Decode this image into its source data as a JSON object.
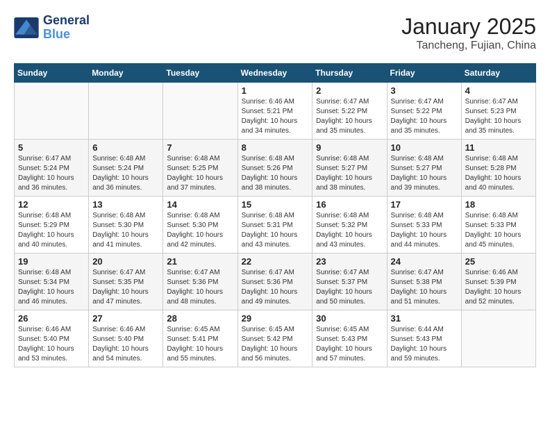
{
  "header": {
    "logo_line1": "General",
    "logo_line2": "Blue",
    "month": "January 2025",
    "location": "Tancheng, Fujian, China"
  },
  "days_of_week": [
    "Sunday",
    "Monday",
    "Tuesday",
    "Wednesday",
    "Thursday",
    "Friday",
    "Saturday"
  ],
  "weeks": [
    [
      {
        "num": "",
        "info": ""
      },
      {
        "num": "",
        "info": ""
      },
      {
        "num": "",
        "info": ""
      },
      {
        "num": "1",
        "info": "Sunrise: 6:46 AM\nSunset: 5:21 PM\nDaylight: 10 hours\nand 34 minutes."
      },
      {
        "num": "2",
        "info": "Sunrise: 6:47 AM\nSunset: 5:22 PM\nDaylight: 10 hours\nand 35 minutes."
      },
      {
        "num": "3",
        "info": "Sunrise: 6:47 AM\nSunset: 5:22 PM\nDaylight: 10 hours\nand 35 minutes."
      },
      {
        "num": "4",
        "info": "Sunrise: 6:47 AM\nSunset: 5:23 PM\nDaylight: 10 hours\nand 35 minutes."
      }
    ],
    [
      {
        "num": "5",
        "info": "Sunrise: 6:47 AM\nSunset: 5:24 PM\nDaylight: 10 hours\nand 36 minutes."
      },
      {
        "num": "6",
        "info": "Sunrise: 6:48 AM\nSunset: 5:24 PM\nDaylight: 10 hours\nand 36 minutes."
      },
      {
        "num": "7",
        "info": "Sunrise: 6:48 AM\nSunset: 5:25 PM\nDaylight: 10 hours\nand 37 minutes."
      },
      {
        "num": "8",
        "info": "Sunrise: 6:48 AM\nSunset: 5:26 PM\nDaylight: 10 hours\nand 38 minutes."
      },
      {
        "num": "9",
        "info": "Sunrise: 6:48 AM\nSunset: 5:27 PM\nDaylight: 10 hours\nand 38 minutes."
      },
      {
        "num": "10",
        "info": "Sunrise: 6:48 AM\nSunset: 5:27 PM\nDaylight: 10 hours\nand 39 minutes."
      },
      {
        "num": "11",
        "info": "Sunrise: 6:48 AM\nSunset: 5:28 PM\nDaylight: 10 hours\nand 40 minutes."
      }
    ],
    [
      {
        "num": "12",
        "info": "Sunrise: 6:48 AM\nSunset: 5:29 PM\nDaylight: 10 hours\nand 40 minutes."
      },
      {
        "num": "13",
        "info": "Sunrise: 6:48 AM\nSunset: 5:30 PM\nDaylight: 10 hours\nand 41 minutes."
      },
      {
        "num": "14",
        "info": "Sunrise: 6:48 AM\nSunset: 5:30 PM\nDaylight: 10 hours\nand 42 minutes."
      },
      {
        "num": "15",
        "info": "Sunrise: 6:48 AM\nSunset: 5:31 PM\nDaylight: 10 hours\nand 43 minutes."
      },
      {
        "num": "16",
        "info": "Sunrise: 6:48 AM\nSunset: 5:32 PM\nDaylight: 10 hours\nand 43 minutes."
      },
      {
        "num": "17",
        "info": "Sunrise: 6:48 AM\nSunset: 5:33 PM\nDaylight: 10 hours\nand 44 minutes."
      },
      {
        "num": "18",
        "info": "Sunrise: 6:48 AM\nSunset: 5:33 PM\nDaylight: 10 hours\nand 45 minutes."
      }
    ],
    [
      {
        "num": "19",
        "info": "Sunrise: 6:48 AM\nSunset: 5:34 PM\nDaylight: 10 hours\nand 46 minutes."
      },
      {
        "num": "20",
        "info": "Sunrise: 6:47 AM\nSunset: 5:35 PM\nDaylight: 10 hours\nand 47 minutes."
      },
      {
        "num": "21",
        "info": "Sunrise: 6:47 AM\nSunset: 5:36 PM\nDaylight: 10 hours\nand 48 minutes."
      },
      {
        "num": "22",
        "info": "Sunrise: 6:47 AM\nSunset: 5:36 PM\nDaylight: 10 hours\nand 49 minutes."
      },
      {
        "num": "23",
        "info": "Sunrise: 6:47 AM\nSunset: 5:37 PM\nDaylight: 10 hours\nand 50 minutes."
      },
      {
        "num": "24",
        "info": "Sunrise: 6:47 AM\nSunset: 5:38 PM\nDaylight: 10 hours\nand 51 minutes."
      },
      {
        "num": "25",
        "info": "Sunrise: 6:46 AM\nSunset: 5:39 PM\nDaylight: 10 hours\nand 52 minutes."
      }
    ],
    [
      {
        "num": "26",
        "info": "Sunrise: 6:46 AM\nSunset: 5:40 PM\nDaylight: 10 hours\nand 53 minutes."
      },
      {
        "num": "27",
        "info": "Sunrise: 6:46 AM\nSunset: 5:40 PM\nDaylight: 10 hours\nand 54 minutes."
      },
      {
        "num": "28",
        "info": "Sunrise: 6:45 AM\nSunset: 5:41 PM\nDaylight: 10 hours\nand 55 minutes."
      },
      {
        "num": "29",
        "info": "Sunrise: 6:45 AM\nSunset: 5:42 PM\nDaylight: 10 hours\nand 56 minutes."
      },
      {
        "num": "30",
        "info": "Sunrise: 6:45 AM\nSunset: 5:43 PM\nDaylight: 10 hours\nand 57 minutes."
      },
      {
        "num": "31",
        "info": "Sunrise: 6:44 AM\nSunset: 5:43 PM\nDaylight: 10 hours\nand 59 minutes."
      },
      {
        "num": "",
        "info": ""
      }
    ]
  ]
}
